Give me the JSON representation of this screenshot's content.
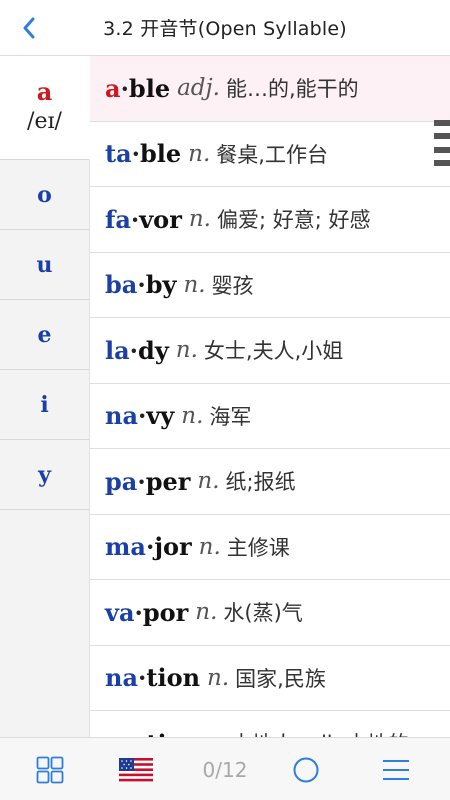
{
  "header": {
    "title": "3.2 开音节(Open Syllable)",
    "back_icon": "chevron-left-icon"
  },
  "sidebar": {
    "items": [
      {
        "letter": "a",
        "ipa": "/eɪ/",
        "active": true
      },
      {
        "letter": "o"
      },
      {
        "letter": "u"
      },
      {
        "letter": "e"
      },
      {
        "letter": "i"
      },
      {
        "letter": "y"
      }
    ]
  },
  "words": [
    {
      "syllable_1": "a",
      "syllable_2": "ble",
      "pos": "adj.",
      "meaning": "能…的,能干的",
      "highlighted": true
    },
    {
      "syllable_1": "ta",
      "syllable_2": "ble",
      "pos": "n.",
      "meaning": "餐桌,工作台"
    },
    {
      "syllable_1": "fa",
      "syllable_2": "vor",
      "pos": "n.",
      "meaning": "偏爱; 好意; 好感"
    },
    {
      "syllable_1": "ba",
      "syllable_2": "by",
      "pos": "n.",
      "meaning": "婴孩"
    },
    {
      "syllable_1": "la",
      "syllable_2": "dy",
      "pos": "n.",
      "meaning": "女士,夫人,小姐"
    },
    {
      "syllable_1": "na",
      "syllable_2": "vy",
      "pos": "n.",
      "meaning": "海军"
    },
    {
      "syllable_1": "pa",
      "syllable_2": "per",
      "pos": "n.",
      "meaning": "纸;报纸"
    },
    {
      "syllable_1": "ma",
      "syllable_2": "jor",
      "pos": "n.",
      "meaning": "主修课"
    },
    {
      "syllable_1": "va",
      "syllable_2": "por",
      "pos": "n.",
      "meaning": "水(蒸)气"
    },
    {
      "syllable_1": "na",
      "syllable_2": "tion",
      "pos": "n.",
      "meaning": "国家,民族"
    },
    {
      "syllable_1": "na",
      "syllable_2": "tive",
      "pos": "n.",
      "meaning": "本地人 adj. 本地的"
    }
  ],
  "footer": {
    "counter": "0/12",
    "icons": [
      "grid-icon",
      "us-flag-icon",
      "circle-icon",
      "menu-icon"
    ]
  },
  "colors": {
    "accent_blue": "#1a3fa6",
    "accent_red": "#d0161e",
    "highlight_bg": "#fdf1f6"
  }
}
